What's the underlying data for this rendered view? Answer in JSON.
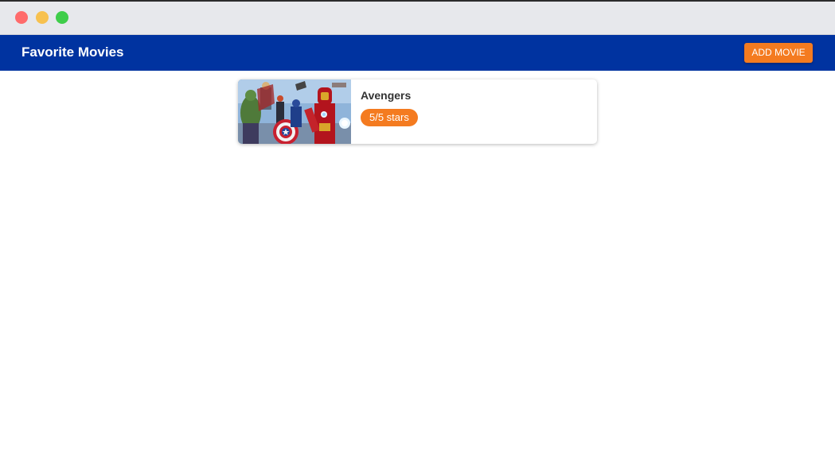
{
  "appbar": {
    "title": "Favorite Movies",
    "add_button_label": "ADD MOVIE"
  },
  "movies": [
    {
      "title": "Avengers",
      "rating_label": "5/5 stars",
      "rating": 5,
      "rating_max": 5
    }
  ],
  "colors": {
    "appbar_background": "#0033a0",
    "accent": "#f47b20",
    "titlebar": "#e7e8ec"
  },
  "icons": {
    "window_controls": [
      "close-dot-icon",
      "minimize-dot-icon",
      "maximize-dot-icon"
    ]
  }
}
